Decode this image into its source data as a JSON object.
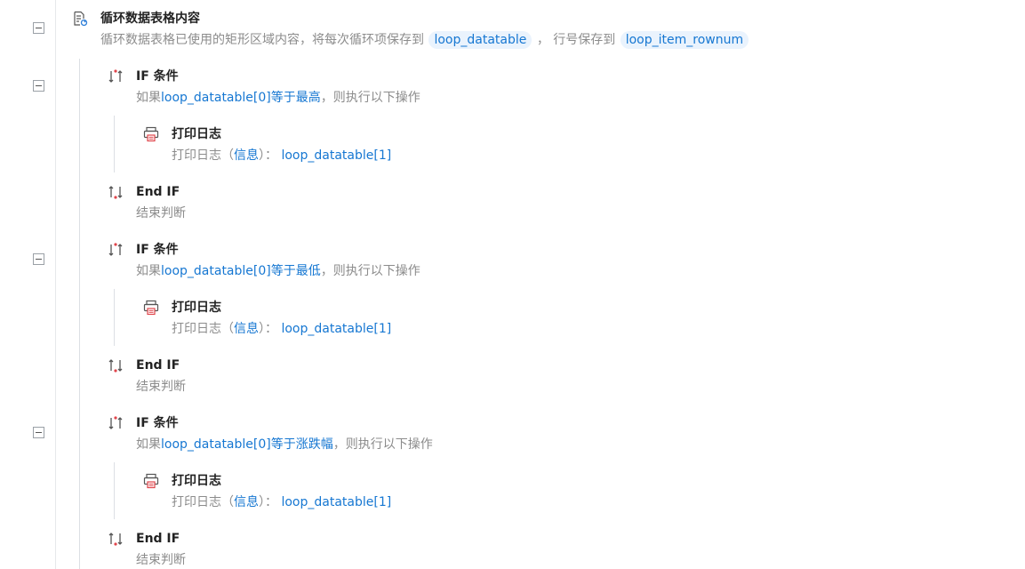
{
  "loop": {
    "title": "循环数据表格内容",
    "desc_prefix": "循环数据表格已使用的矩形区域内容，将每次循环项保存到",
    "var_item": "loop_datatable",
    "desc_middle": "， 行号保存到",
    "var_rownum": "loop_item_rownum"
  },
  "blocks": [
    {
      "if_title": "IF 条件",
      "if_desc": {
        "prefix": "如果",
        "condition": "loop_datatable[0]等于最高",
        "suffix": "，则执行以下操作"
      },
      "log_title": "打印日志",
      "log_desc": {
        "prefix": "打印日志（",
        "level": "信息",
        "middle": "）：",
        "value": "loop_datatable[1]"
      },
      "end_title": "End IF",
      "end_desc": "结束判断"
    },
    {
      "if_title": "IF 条件",
      "if_desc": {
        "prefix": "如果",
        "condition": "loop_datatable[0]等于最低",
        "suffix": "，则执行以下操作"
      },
      "log_title": "打印日志",
      "log_desc": {
        "prefix": "打印日志（",
        "level": "信息",
        "middle": "）：",
        "value": "loop_datatable[1]"
      },
      "end_title": "End IF",
      "end_desc": "结束判断"
    },
    {
      "if_title": "IF 条件",
      "if_desc": {
        "prefix": "如果",
        "condition": "loop_datatable[0]等于涨跌幅",
        "suffix": "，则执行以下操作"
      },
      "log_title": "打印日志",
      "log_desc": {
        "prefix": "打印日志（",
        "level": "信息",
        "middle": "）：",
        "value": "loop_datatable[1]"
      },
      "end_title": "End IF",
      "end_desc": "结束判断"
    }
  ],
  "icons": {
    "loop": "table-loop-icon",
    "if": "if-branch-icon",
    "log": "printer-icon",
    "endif": "end-if-icon"
  },
  "colors": {
    "highlight": "#1677d2",
    "chip_bg": "#eaf3fd",
    "icon_red": "#e0454b"
  }
}
